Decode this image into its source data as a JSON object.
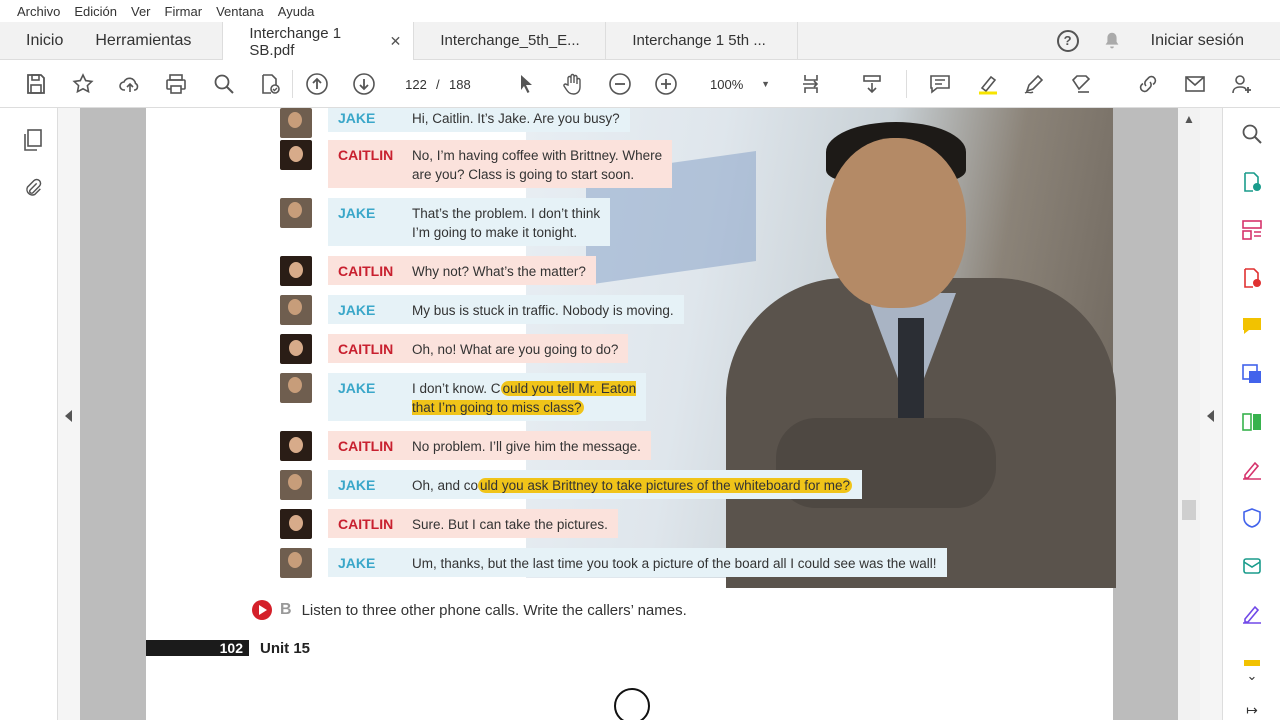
{
  "menu": [
    "Archivo",
    "Edición",
    "Ver",
    "Firmar",
    "Ventana",
    "Ayuda"
  ],
  "tabs": {
    "home": "Inicio",
    "tools": "Herramientas",
    "documents": [
      {
        "label": "Interchange 1 SB.pdf",
        "active": true
      },
      {
        "label": "Interchange_5th_E...",
        "active": false
      },
      {
        "label": "Interchange 1 5th ...",
        "active": false
      }
    ],
    "close_glyph": "✕",
    "signin": "Iniciar sesión"
  },
  "toolbar": {
    "page_current": "122",
    "page_sep": "/",
    "page_total": "188",
    "zoom": "100%"
  },
  "colors": {
    "jake": "#3aa7c9",
    "caitlin": "#c8202f",
    "highlight": "#f0c419",
    "accent_red": "#d4202a"
  },
  "dialogue": [
    {
      "speaker": "JAKE",
      "who": "jake",
      "pre": "Hi, Caitlin. It’s Jake. Are you busy?",
      "hl": "",
      "post": ""
    },
    {
      "speaker": "CAITLIN",
      "who": "caitlin",
      "pre": "No, I’m having coffee with Brittney. Where\nare you? Class is going to start soon.",
      "hl": "",
      "post": ""
    },
    {
      "speaker": "JAKE",
      "who": "jake",
      "pre": "That’s the problem. I don’t think\nI’m going to make it tonight.",
      "hl": "",
      "post": ""
    },
    {
      "speaker": "CAITLIN",
      "who": "caitlin",
      "pre": "Why not? What’s the matter?",
      "hl": "",
      "post": ""
    },
    {
      "speaker": "JAKE",
      "who": "jake",
      "pre": "My bus is stuck in traffic. Nobody is moving.",
      "hl": "",
      "post": ""
    },
    {
      "speaker": "CAITLIN",
      "who": "caitlin",
      "pre": "Oh, no! What are you going to do?",
      "hl": "",
      "post": ""
    },
    {
      "speaker": "JAKE",
      "who": "jake",
      "pre": "I don’t know. C",
      "hl": "ould you tell Mr. Eaton\nthat I’m going to miss class?",
      "post": ""
    },
    {
      "speaker": "CAITLIN",
      "who": "caitlin",
      "pre": "No problem. I’ll give him the message.",
      "hl": "",
      "post": ""
    },
    {
      "speaker": "JAKE",
      "who": "jake",
      "pre": "Oh, and co",
      "hl": "uld you ask Brittney to take pictures of the whiteboard for me?",
      "post": ""
    },
    {
      "speaker": "CAITLIN",
      "who": "caitlin",
      "pre": "Sure. But I can take the pictures.",
      "hl": "",
      "post": ""
    },
    {
      "speaker": "JAKE",
      "who": "jake",
      "pre": "Um, thanks, but the last time you took a picture of the board all I could see was the wall!",
      "hl": "",
      "post": ""
    }
  ],
  "exercise_b": {
    "letter": "B",
    "text": "Listen to three other phone calls. Write the callers’ names."
  },
  "footer": {
    "page_number": "102",
    "unit": "Unit 15"
  }
}
